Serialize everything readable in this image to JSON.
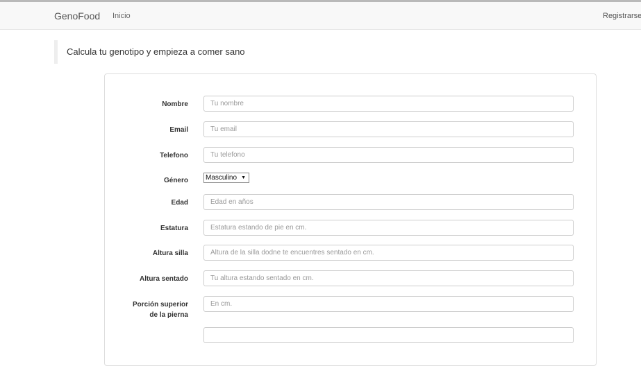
{
  "navbar": {
    "brand": "GenoFood",
    "home_link": "Inicio",
    "register_link": "Registrarse"
  },
  "page": {
    "heading": "Calcula tu genotipo y empieza a comer sano"
  },
  "form": {
    "fields": [
      {
        "label": "Nombre",
        "placeholder": "Tu nombre"
      },
      {
        "label": "Email",
        "placeholder": "Tu email"
      },
      {
        "label": "Telefono",
        "placeholder": "Tu telefono"
      },
      {
        "label": "Género",
        "selected": "Masculino"
      },
      {
        "label": "Edad",
        "placeholder": "Edad en años"
      },
      {
        "label": "Estatura",
        "placeholder": "Estatura estando de pie en cm."
      },
      {
        "label": "Altura silla",
        "placeholder": "Altura de la silla dodne te encuentres sentado en cm."
      },
      {
        "label": "Altura sentado",
        "placeholder": "Tu altura estando sentado en cm."
      },
      {
        "label_line1": "Porción superior",
        "label_line2": "de la pierna",
        "placeholder": "En cm."
      },
      {
        "label": "",
        "placeholder": ""
      }
    ]
  },
  "colors": {
    "navbar_bg": "#f8f8f8",
    "border": "#cccccc",
    "text": "#333333"
  }
}
